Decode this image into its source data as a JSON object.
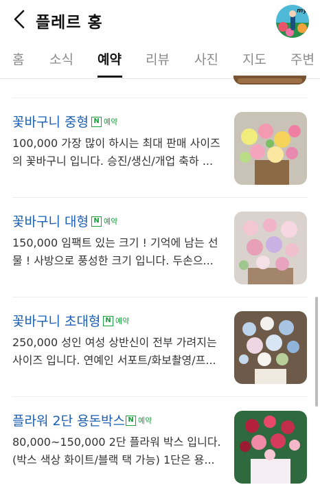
{
  "header": {
    "title": "플레르 홍",
    "avatar_text": "my"
  },
  "tabs": [
    {
      "label": "홈"
    },
    {
      "label": "소식"
    },
    {
      "label": "예약"
    },
    {
      "label": "리뷰"
    },
    {
      "label": "사진"
    },
    {
      "label": "지도"
    },
    {
      "label": "주변"
    }
  ],
  "active_tab": "예약",
  "items": [
    {
      "title": "꽃바구니 중형",
      "badge_icon": "N",
      "badge": "예약",
      "desc_line1": "100,000 가장 많이 하시는 최대 판매 사이즈",
      "desc_line2": "의 꽃바구니 입니다. 승진/생신/개업 축하 ..."
    },
    {
      "title": "꽃바구니 대형",
      "badge_icon": "N",
      "badge": "예약",
      "desc_line1": "150,000 임팩트 있는 크기 ! 기억에 남는 선",
      "desc_line2": "물 ! 사방으로 풍성한 크기 입니다. 두손으..."
    },
    {
      "title": "꽃바구니 초대형",
      "badge_icon": "N",
      "badge": "예약",
      "desc_line1": "250,000 성인 여성 상반신이 전부 가려지는",
      "desc_line2": "사이즈 입니다. 연예인 서포트/화보촬영/프..."
    },
    {
      "title": "플라워 2단 용돈박스",
      "badge_icon": "N",
      "badge": "예약",
      "desc_line1": "80,000~150,000 2단 플라워 박스 입니다.",
      "desc_line2": "(박스 색상 화이트/블랙 택 가능) 1단은 용..."
    }
  ]
}
